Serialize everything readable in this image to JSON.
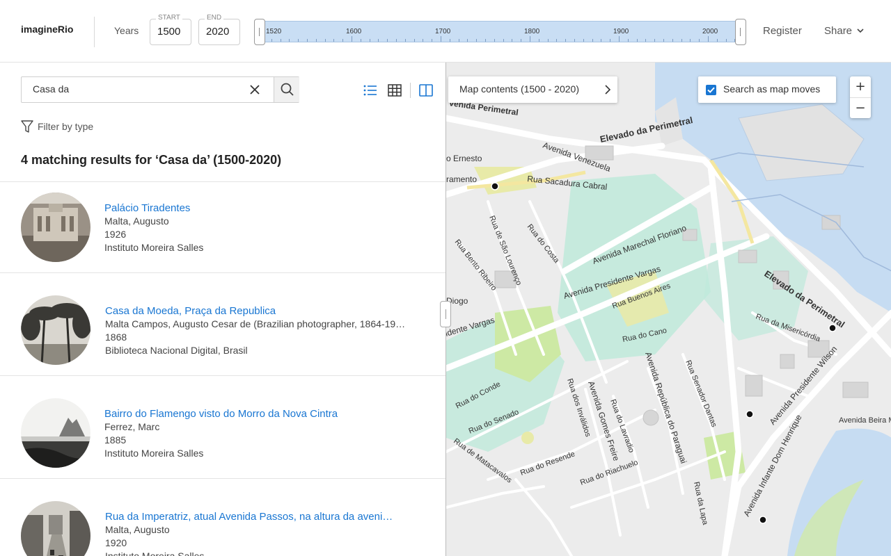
{
  "header": {
    "logo": "imagineRio",
    "years_label": "Years",
    "start_caption": "START",
    "start_value": "1500",
    "end_caption": "END",
    "end_value": "2020",
    "timeline_labels": [
      "1520",
      "1600",
      "1700",
      "1800",
      "1900",
      "2000"
    ],
    "register": "Register",
    "share": "Share"
  },
  "search": {
    "value": "Casa da"
  },
  "filter_label": "Filter by type",
  "results_title": "4 matching results for ‘Casa da’ (1500-2020)",
  "results": [
    {
      "title": "Palácio Tiradentes",
      "creator": "Malta, Augusto",
      "year": "1926",
      "source": "Instituto Moreira Salles"
    },
    {
      "title": "Casa da Moeda, Praça da Republica",
      "creator": "Malta Campos, Augusto Cesar de (Brazilian photographer, 1864-19…",
      "year": "1868",
      "source": "Biblioteca Nacional Digital, Brasil"
    },
    {
      "title": "Bairro do Flamengo visto do Morro da Nova Cintra",
      "creator": "Ferrez, Marc",
      "year": "1885",
      "source": "Instituto Moreira Salles"
    },
    {
      "title": "Rua da Imperatriz, atual Avenida Passos, na altura da aveni…",
      "creator": "Malta, Augusto",
      "year": "1920",
      "source": "Instituto Moreira Salles"
    }
  ],
  "map": {
    "contents_label": "Map contents (1500 - 2020)",
    "search_as_moves": "Search as map moves",
    "search_as_moves_checked": true,
    "zoom_in": "+",
    "zoom_out": "−",
    "streets": {
      "perimetral_top": "venida Perimetral",
      "venezuela": "Avenida Venezuela",
      "elevado_top": "Elevado da Perimetral",
      "ernesto": "o Ernesto",
      "livramento": "ramento",
      "sacadura": "Rua Sacadura Cabral",
      "sao_lourenco": "Rua de São Lourenço",
      "costa": "Rua do Costa",
      "bento": "Rua Bento Ribeiro",
      "floriano": "Avenida Marechal Floriano",
      "pres_vargas": "Avenida Presidente Vargas",
      "buenos_aires": "Rua Buenos Aires",
      "diogo": "Diogo",
      "idente_vargas": "idente Vargas",
      "cano": "Rua do Cano",
      "elevado_right": "Elevado da Perimetral",
      "misericordia": "Rua da Misericórdia",
      "wilson": "Avenida Presidente Wilson",
      "beira": "Avenida Beira M",
      "conde": "Rua do Conde",
      "senado": "Rua do Senado",
      "invalidos": "Rua dos Inválidos",
      "gomes_freire": "Avenida Gomes Freire",
      "lavradio": "Rua do Lavradio",
      "republica_paraguai": "Avenida República do Paraguai",
      "senador_dantas": "Rua Senador Dantas",
      "lapa": "Rua da Lapa",
      "matacavalos": "Rua de Matacavalos",
      "resende": "Rua do Resende",
      "riachuelo": "Rua do Riachuelo",
      "dom_henrique": "Avenida Infante Dom Henrique"
    }
  },
  "colors": {
    "accent": "#1976d2",
    "water": "#c6dcf2",
    "park": "#cde9a4",
    "plaza": "#bfeadb",
    "land": "#ececec"
  }
}
